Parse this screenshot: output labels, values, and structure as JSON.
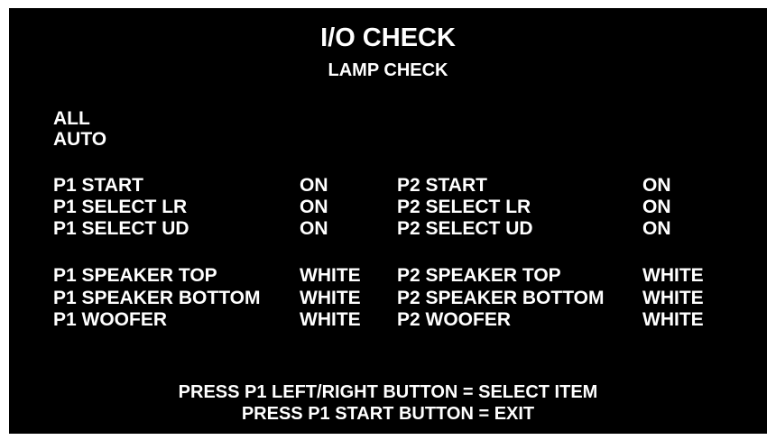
{
  "screen": {
    "title": "I/O CHECK",
    "subtitle": "LAMP CHECK"
  },
  "menu": {
    "all": "ALL",
    "auto": "AUTO"
  },
  "buttons": {
    "rows": [
      {
        "p1_label": "P1 START",
        "p1_value": "ON",
        "p2_label": "P2 START",
        "p2_value": "ON"
      },
      {
        "p1_label": "P1 SELECT LR",
        "p1_value": "ON",
        "p2_label": "P2 SELECT LR",
        "p2_value": "ON"
      },
      {
        "p1_label": "P1 SELECT UD",
        "p1_value": "ON",
        "p2_label": "P2 SELECT UD",
        "p2_value": "ON"
      }
    ]
  },
  "speakers": {
    "rows": [
      {
        "p1_label": "P1 SPEAKER TOP",
        "p1_value": "WHITE",
        "p2_label": "P2 SPEAKER TOP",
        "p2_value": "WHITE"
      },
      {
        "p1_label": "P1 SPEAKER BOTTOM",
        "p1_value": "WHITE",
        "p2_label": "P2 SPEAKER BOTTOM",
        "p2_value": "WHITE"
      },
      {
        "p1_label": "P1 WOOFER",
        "p1_value": "WHITE",
        "p2_label": "P2 WOOFER",
        "p2_value": "WHITE"
      }
    ]
  },
  "footer": {
    "line1": "PRESS P1 LEFT/RIGHT BUTTON = SELECT ITEM",
    "line2": "PRESS P1 START BUTTON = EXIT"
  },
  "colors": {
    "background": "#000000",
    "text": "#ffffff"
  }
}
